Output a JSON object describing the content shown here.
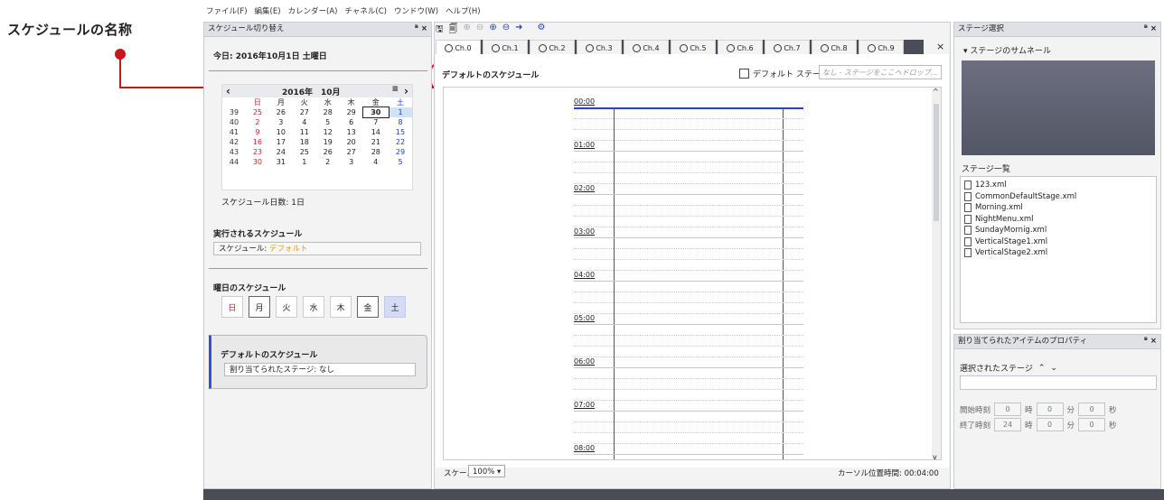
{
  "callout": {
    "text": "スケジュールの名称"
  },
  "menu": [
    "ファイル(F)",
    "編集(E)",
    "カレンダー(A)",
    "チャネル(C)",
    "ウンドウ(W)",
    "ヘルプ(H)"
  ],
  "left_panel": {
    "title": "スケジュール切り替え",
    "controls": "ᴮ ×",
    "today": "今日: 2016年10月1日 土曜日",
    "calendar": {
      "month_label": "2016年　10月",
      "prev": "‹",
      "next": "›",
      "menu_icon": "≡",
      "weekdays": [
        "日",
        "月",
        "火",
        "水",
        "木",
        "金",
        "土"
      ],
      "rows": [
        {
          "wk": "39",
          "days": [
            "25",
            "26",
            "27",
            "28",
            "29",
            "30",
            "1"
          ]
        },
        {
          "wk": "40",
          "days": [
            "2",
            "3",
            "4",
            "5",
            "6",
            "7",
            "8"
          ]
        },
        {
          "wk": "41",
          "days": [
            "9",
            "10",
            "11",
            "12",
            "13",
            "14",
            "15"
          ]
        },
        {
          "wk": "42",
          "days": [
            "16",
            "17",
            "18",
            "19",
            "20",
            "21",
            "22"
          ]
        },
        {
          "wk": "43",
          "days": [
            "23",
            "24",
            "25",
            "26",
            "27",
            "28",
            "29"
          ]
        },
        {
          "wk": "44",
          "days": [
            "30",
            "31",
            "1",
            "2",
            "3",
            "4",
            "5"
          ]
        }
      ]
    },
    "schedule_days": "スケジュール日数: 1日",
    "executed_title": "実行されるスケジュール",
    "executed_label": "スケジュール:",
    "executed_value": "デフォルト",
    "weekday_title": "曜日のスケジュール",
    "weekday_buttons": [
      "日",
      "月",
      "火",
      "水",
      "木",
      "金",
      "土"
    ],
    "default_title": "デフォルトのスケジュール",
    "default_stage": "割り当てられたステージ: なし"
  },
  "center": {
    "channels": [
      "Ch.0",
      "Ch.1",
      "Ch.2",
      "Ch.3",
      "Ch.4",
      "Ch.5",
      "Ch.6",
      "Ch.7",
      "Ch.8",
      "Ch.9"
    ],
    "close": "×",
    "schedule_name": "デフォルトのスケジュール",
    "default_stage_label": "デフォルト ステージ",
    "drop_placeholder": "なし - ステージをここへドロップ...",
    "hours": [
      "00:00",
      "01:00",
      "02:00",
      "03:00",
      "04:00",
      "05:00",
      "06:00",
      "07:00",
      "08:00"
    ],
    "scale_label": "スケール",
    "scale_value": "100%",
    "cursor_time": "カーソル位置時間: 00:04:00"
  },
  "right_top": {
    "title": "ステージ選択",
    "controls": "ᴮ ×",
    "thumb_label": "ステージのサムネール",
    "list_title": "ステージ一覧",
    "files": [
      "123.xml",
      "CommonDefaultStage.xml",
      "Morning.xml",
      "NightMenu.xml",
      "SundayMornig.xml",
      "VerticalStage1.xml",
      "VerticalStage2.xml"
    ]
  },
  "right_bot": {
    "title": "割り当てられたアイテムのプロパティ",
    "controls": "ᴮ ×",
    "selected_label": "選択されたステージ",
    "start_label": "開始時刻",
    "end_label": "終了時刻",
    "start": {
      "h": "0",
      "m": "0",
      "s": "0"
    },
    "end": {
      "h": "24",
      "m": "0",
      "s": "0"
    },
    "unit_h": "時",
    "unit_m": "分",
    "unit_s": "秒"
  }
}
